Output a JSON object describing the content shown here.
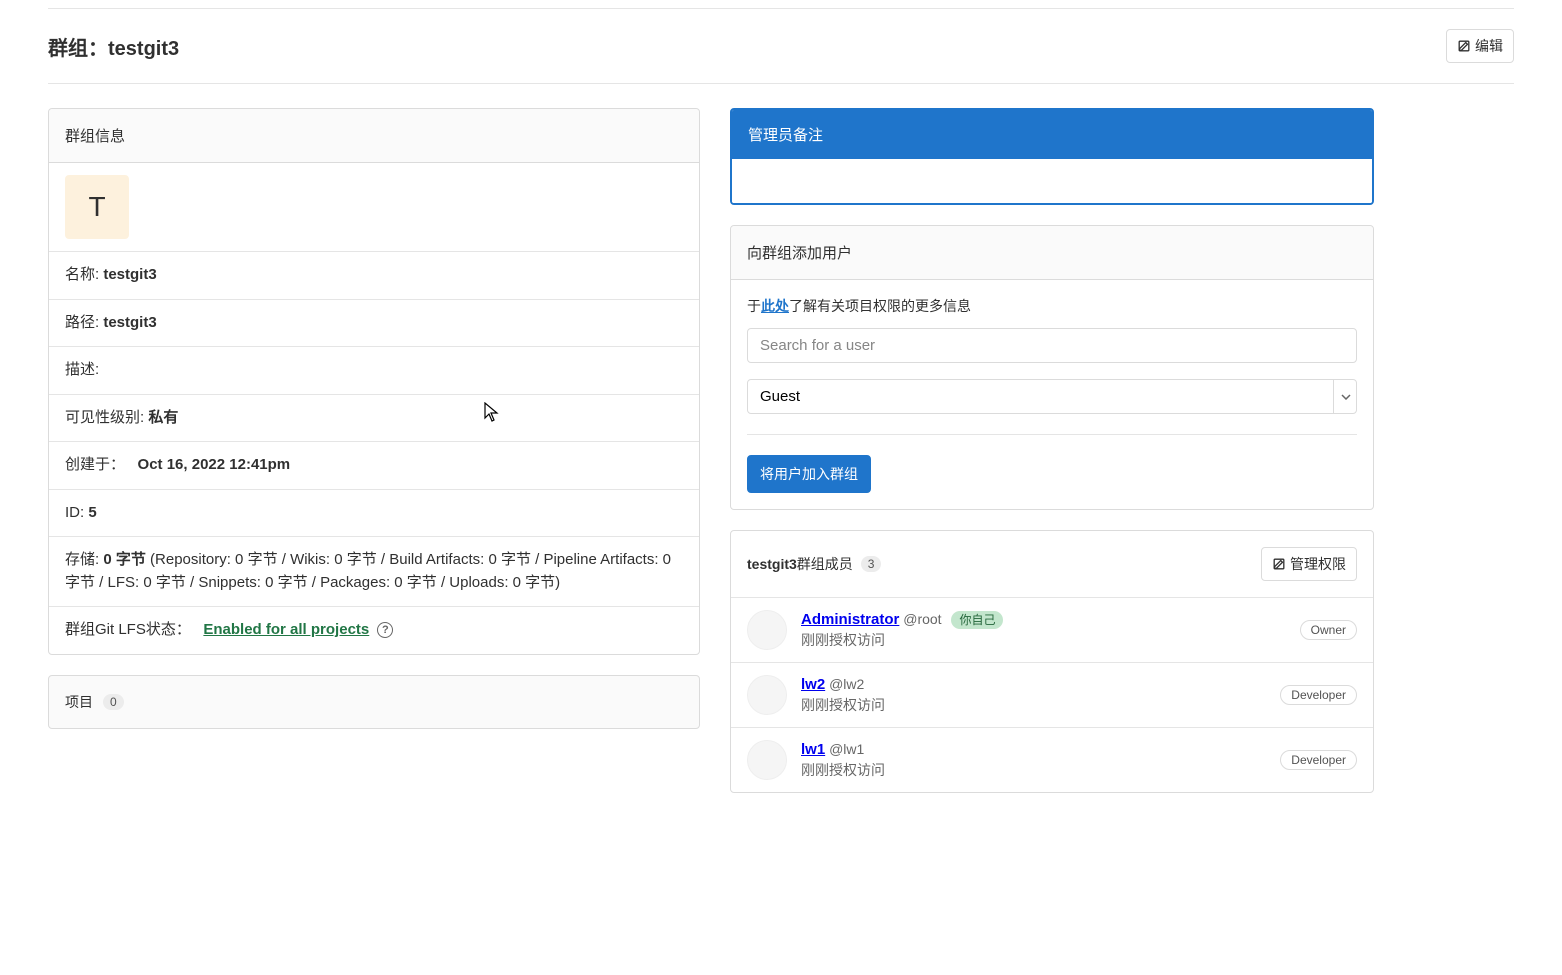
{
  "header": {
    "title_prefix": "群组：",
    "group_name": "testgit3",
    "edit_label": "编辑"
  },
  "group_info": {
    "header": "群组信息",
    "avatar_letter": "T",
    "name_label": "名称:",
    "name_value": "testgit3",
    "path_label": "路径:",
    "path_value": "testgit3",
    "desc_label": "描述:",
    "visibility_label": "可见性级别:",
    "visibility_value": "私有",
    "created_label": "创建于：",
    "created_value": "Oct 16, 2022 12:41pm",
    "id_label": "ID:",
    "id_value": "5",
    "storage_label": "存储:",
    "storage_value": "0 字节",
    "storage_detail": " (Repository: 0 字节 / Wikis: 0 字节 / Build Artifacts: 0 字节 / Pipeline Artifacts: 0 字节 / LFS: 0 字节 / Snippets: 0 字节 / Packages: 0 字节 / Uploads: 0 字节)",
    "lfs_label": "群组Git LFS状态：",
    "lfs_value": "Enabled for all projects"
  },
  "projects": {
    "label": "项目",
    "count": "0"
  },
  "admin_notes": {
    "header": "管理员备注"
  },
  "add_user": {
    "header": "向群组添加用户",
    "info_prefix": "于",
    "info_link": "此处",
    "info_suffix": "了解有关项目权限的更多信息",
    "search_placeholder": "Search for a user",
    "role_value": "Guest",
    "submit_label": "将用户加入群组"
  },
  "members": {
    "title_prefix": "testgit3",
    "title_suffix": "群组成员",
    "count": "3",
    "manage_label": "管理权限",
    "rows": [
      {
        "name": "Administrator",
        "handle": "@root",
        "self_label": "你自己",
        "access": "刚刚授权访问",
        "role": "Owner",
        "is_self": true
      },
      {
        "name": "lw2",
        "handle": "@lw2",
        "access": "刚刚授权访问",
        "role": "Developer",
        "is_self": false
      },
      {
        "name": "lw1",
        "handle": "@lw1",
        "access": "刚刚授权访问",
        "role": "Developer",
        "is_self": false
      }
    ]
  }
}
